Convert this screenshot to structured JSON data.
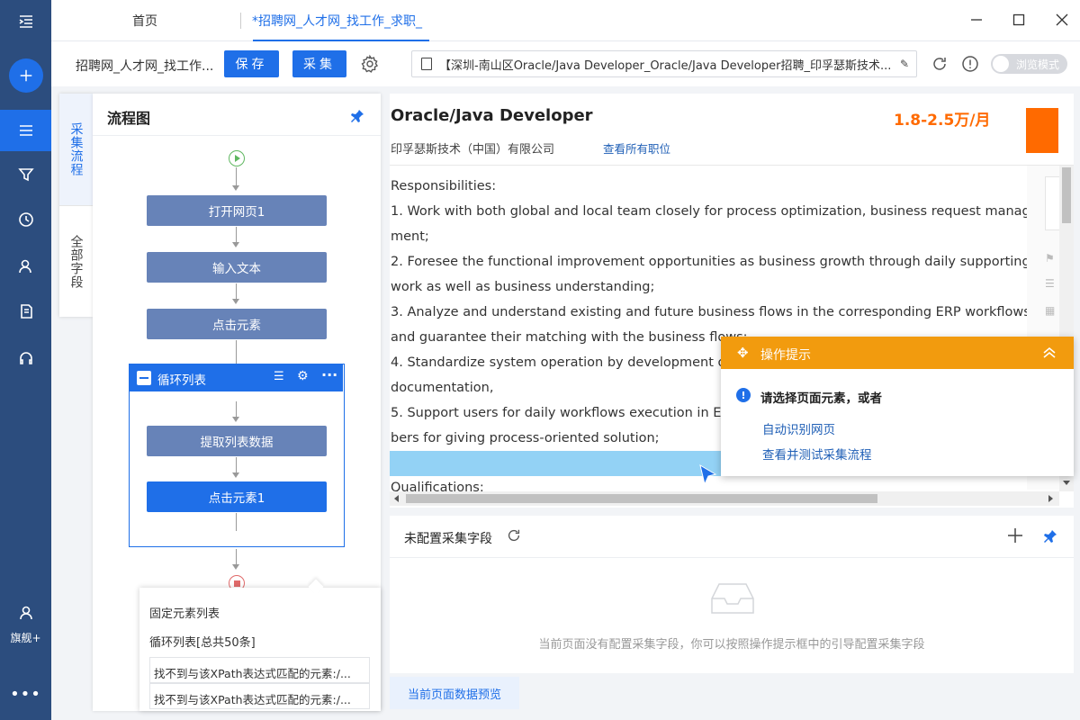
{
  "leftbar": {
    "flagship_label": "旗舰+"
  },
  "titlebar": {
    "tabs": [
      {
        "label": "首页"
      },
      {
        "label": "*招聘网_人才网_找工作_求职_"
      }
    ]
  },
  "toolbar": {
    "task_name": "招聘网_人才网_找工作...",
    "save_label": "保存",
    "collect_label": "采集",
    "url": "【深圳-南山区Oracle/Java Developer_Oracle/Java Developer招聘_印孚瑟斯技术...",
    "browse_mode_label": "浏览模式"
  },
  "sidetabs": {
    "collect_flow": "采集流程",
    "all_fields": "全部字段"
  },
  "flow": {
    "title": "流程图",
    "nodes": {
      "open_page": "打开网页1",
      "input_text": "输入文本",
      "click_element": "点击元素",
      "extract_list": "提取列表数据",
      "click_element1": "点击元素1"
    },
    "loop_title": "循环列表"
  },
  "loop_popup": {
    "heading": "固定元素列表",
    "summary": "循环列表[总共50条]",
    "items": [
      "找不到与该XPath表达式匹配的元素:/...",
      "找不到与该XPath表达式匹配的元素:/..."
    ]
  },
  "job": {
    "title": "Oracle/Java Developer",
    "salary": "1.8-2.5万/月",
    "company": "印孚瑟斯技术（中国）有限公司",
    "view_all_jobs": "查看所有职位",
    "lines": [
      "Responsibilities:",
      "1. Work with both global and local team closely for process optimization, business request manage",
      "ment;",
      "2. Foresee the functional improvement opportunities as business growth through daily supporting",
      "work as well as business understanding;",
      "3. Analyze and understand existing and future business flows in the corresponding ERP workflows",
      "and guarantee their matching with the business flows;",
      "4. Standardize system operation by development of ke",
      "documentation,",
      "5. Support users for daily workflows execution in ERP w",
      "bers for giving process-oriented solution;"
    ],
    "qualifications": "Qualifications:"
  },
  "tip": {
    "title": "操作提示",
    "message": "请选择页面元素，或者",
    "link_auto": "自动识别网页",
    "link_test": "查看并测试采集流程"
  },
  "fields": {
    "title": "未配置采集字段",
    "empty_message": "当前页面没有配置采集字段，你可以按照操作提示框中的引导配置采集字段",
    "preview_tab": "当前页面数据预览"
  },
  "colors": {
    "sidebar": "#2c4d7e",
    "primary": "#1f6fe8",
    "node": "#6783b8",
    "salary": "#ff6a00",
    "tip_header": "#f29b0e"
  }
}
